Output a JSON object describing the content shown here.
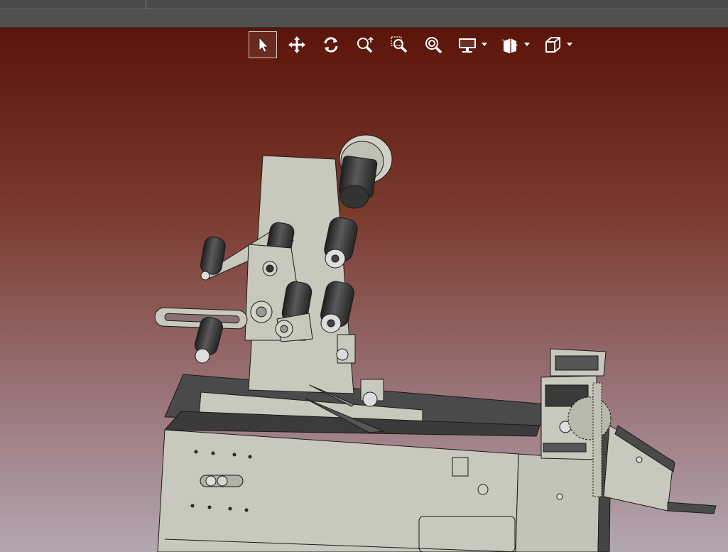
{
  "toolbar": {
    "buttons": [
      {
        "id": "select",
        "icon": "pointer-arrow-icon",
        "active": true
      },
      {
        "id": "pan",
        "icon": "move-arrows-icon",
        "active": false
      },
      {
        "id": "rotate",
        "icon": "rotate-icon",
        "active": false
      },
      {
        "id": "zoom-fit",
        "icon": "zoom-fit-icon",
        "active": false
      },
      {
        "id": "zoom-window",
        "icon": "zoom-window-icon",
        "active": false
      },
      {
        "id": "zoom",
        "icon": "zoom-icon",
        "active": false
      },
      {
        "id": "display",
        "icon": "monitor-icon",
        "active": false
      },
      {
        "id": "section",
        "icon": "section-view-icon",
        "active": false
      },
      {
        "id": "view-cube",
        "icon": "view-cube-icon",
        "active": false
      }
    ]
  },
  "colors": {
    "viewport_top": "#5b1409",
    "viewport_bottom": "#b3a7b2",
    "part_body": "#c8c8bc",
    "part_dark": "#3a3a3a",
    "toolbar_icon": "#ffffff"
  }
}
